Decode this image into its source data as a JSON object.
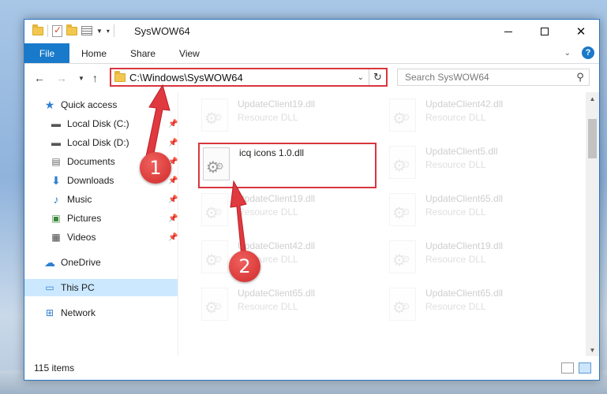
{
  "window": {
    "title": "SysWOW64",
    "ribbon_tabs": [
      "File",
      "Home",
      "Share",
      "View"
    ]
  },
  "address": {
    "path": "C:\\Windows\\SysWOW64",
    "search_placeholder": "Search SysWOW64"
  },
  "sidebar": {
    "items": [
      {
        "label": "Quick access",
        "icon": "star-icon",
        "pinned": false
      },
      {
        "label": "Local Disk (C:)",
        "icon": "drive-icon",
        "pinned": true
      },
      {
        "label": "Local Disk (D:)",
        "icon": "drive-icon",
        "pinned": true
      },
      {
        "label": "Documents",
        "icon": "document-icon",
        "pinned": true
      },
      {
        "label": "Downloads",
        "icon": "download-icon",
        "pinned": true
      },
      {
        "label": "Music",
        "icon": "music-icon",
        "pinned": true
      },
      {
        "label": "Pictures",
        "icon": "pictures-icon",
        "pinned": true
      },
      {
        "label": "Videos",
        "icon": "video-icon",
        "pinned": true
      },
      {
        "label": "OneDrive",
        "icon": "cloud-icon",
        "pinned": false
      },
      {
        "label": "This PC",
        "icon": "computer-icon",
        "pinned": false,
        "selected": true
      },
      {
        "label": "Network",
        "icon": "network-icon",
        "pinned": false
      }
    ]
  },
  "files": [
    {
      "name": "UpdateClient19.dll",
      "type": "Resource DLL"
    },
    {
      "name": "UpdateClient42.dll",
      "type": "Resource DLL"
    },
    {
      "name": "icq icons 1.0.dll",
      "type": ""
    },
    {
      "name": "UpdateClient5.dll",
      "type": "Resource DLL"
    },
    {
      "name": "UpdateClient19.dll",
      "type": "Resource DLL"
    },
    {
      "name": "UpdateClient65.dll",
      "type": "Resource DLL"
    },
    {
      "name": "UpdateClient42.dll",
      "type": "Resource DLL"
    },
    {
      "name": "UpdateClient19.dll",
      "type": "Resource DLL"
    },
    {
      "name": "UpdateClient65.dll",
      "type": "Resource DLL"
    },
    {
      "name": "UpdateClient65.dll",
      "type": "Resource DLL"
    }
  ],
  "status": {
    "item_count": "115 items"
  },
  "annotations": {
    "step1": "1",
    "step2": "2",
    "color": "#d9363e"
  }
}
